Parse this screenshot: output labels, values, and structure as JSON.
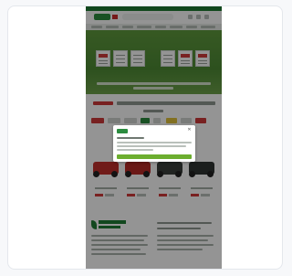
{
  "screenshot": {
    "brand_color": "#1f7d35",
    "accent_color": "#6cae2f",
    "sale_color": "#cf3a3a",
    "icons": [
      "logo-mark",
      "search-box",
      "account-icon",
      "cart-icon",
      "close-icon"
    ]
  },
  "cookie_modal": {
    "close_glyph": "✕"
  }
}
